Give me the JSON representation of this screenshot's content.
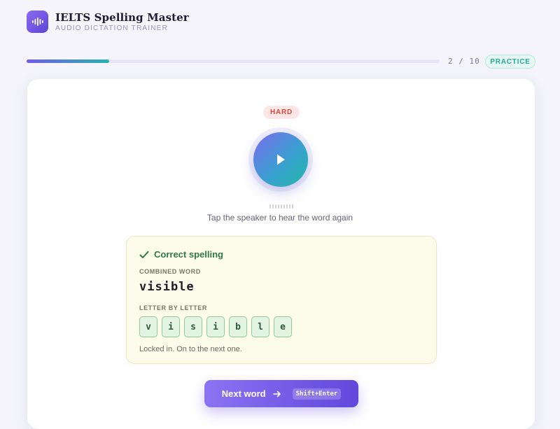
{
  "app": {
    "title": "IELTS Spelling Master",
    "subtitle": "AUDIO DICTATION TRAINER"
  },
  "progress": {
    "current": 2,
    "total": 10,
    "label": "2 / 10",
    "fraction": 0.2,
    "mode": "PRACTICE"
  },
  "word": {
    "difficulty": "HARD",
    "hint": "Tap the speaker to hear the word again"
  },
  "result": {
    "status": "Correct spelling",
    "combined_label": "COMBINED WORD",
    "combined_word": "visible",
    "letters_label": "LETTER BY LETTER",
    "letters": [
      "v",
      "i",
      "s",
      "i",
      "b",
      "l",
      "e"
    ],
    "note": "Locked in. On to the next one."
  },
  "actions": {
    "next_label": "Next word",
    "next_shortcut": "Shift+Enter"
  },
  "colors": {
    "accent": "#6d5ce8",
    "teal": "#2bb3b0",
    "success": "#2f7a45",
    "hard": "#e0453d"
  }
}
